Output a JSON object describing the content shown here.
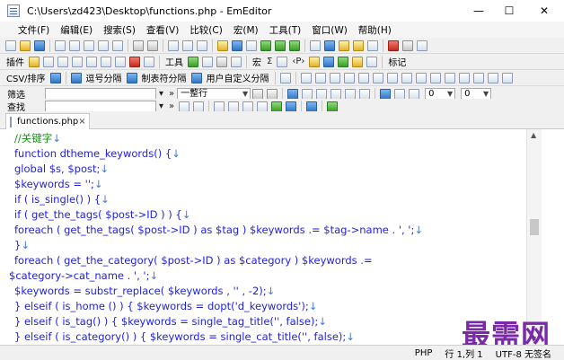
{
  "window": {
    "title": "C:\\Users\\zd423\\Desktop\\functions.php - EmEditor",
    "minimize": "—",
    "maximize": "☐",
    "close": "✕"
  },
  "menu": [
    "文件(F)",
    "编辑(E)",
    "搜索(S)",
    "查看(V)",
    "比较(C)",
    "宏(M)",
    "工具(T)",
    "窗口(W)",
    "帮助(H)"
  ],
  "toolbar2": {
    "plugins_label": "插件",
    "tools_label": "工具",
    "macro_label": "宏",
    "bookmark_label": "标记",
    "sigma_glyph": "Σ",
    "pgrg_glyph": "‹P›"
  },
  "toolbar3": {
    "csv_label": "CSV/排序",
    "comma_label": "逗号分隔",
    "tab_label": "制表符分隔",
    "custom_label": "用户自定义分隔"
  },
  "filter": {
    "label": "筛选",
    "value": "",
    "scope": "一整行",
    "spin1": "0",
    "spin2": "0"
  },
  "find": {
    "label": "查找",
    "value": ""
  },
  "tabs": [
    {
      "label": "functions.php",
      "close": "×"
    }
  ],
  "code_lines": [
    "//关键字",
    "function dtheme_keywords() {",
    "  global $s, $post;",
    "  $keywords = '';",
    "  if ( is_single() ) {",
    "    if ( get_the_tags( $post->ID ) ) {",
    "      foreach ( get_the_tags( $post->ID ) as $tag ) $keywords .= $tag->name . ', ';",
    "    }",
    "    foreach ( get_the_category( $post->ID ) as $category ) $keywords .=",
    "$category->cat_name . ', ';",
    "    $keywords = substr_replace( $keywords , '' , -2);",
    "  } elseif ( is_home () )    { $keywords = dopt('d_keywords');",
    "  } elseif ( is_tag() )     { $keywords = single_tag_title('', false);",
    "  } elseif ( is_category() ) { $keywords = single_cat_title('', false);"
  ],
  "status": {
    "lang": "PHP",
    "position": "行 1,列 1",
    "encoding": "UTF-8 无签名"
  },
  "watermark": "最需网",
  "colors": {
    "keyword": "#1e1ee6",
    "comment": "#1a8a1a",
    "string": "#9a1aa8",
    "watermark": "#7a2aa8"
  }
}
